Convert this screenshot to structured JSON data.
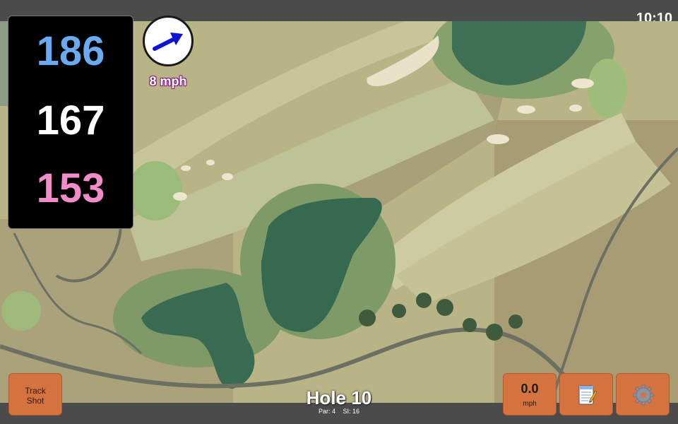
{
  "status": {
    "time": "10:10"
  },
  "yardage": {
    "back": "186",
    "middle": "167",
    "front": "153"
  },
  "wind": {
    "speed": "8 mph",
    "icon": "arrow-right-icon"
  },
  "hole": {
    "title": "Hole 10",
    "par": "Par: 4",
    "si": "SI: 16"
  },
  "buttons": {
    "track_line1": "Track",
    "track_line2": "Shot",
    "speed_value": "0.0",
    "speed_unit": "mph",
    "notes_icon": "notepad-icon",
    "settings_icon": "gear-icon"
  },
  "colors": {
    "button": "#d4733f",
    "back_yardage": "#6aaaf0",
    "front_yardage": "#f08cc8",
    "wind_arrow": "#0a14d2"
  }
}
